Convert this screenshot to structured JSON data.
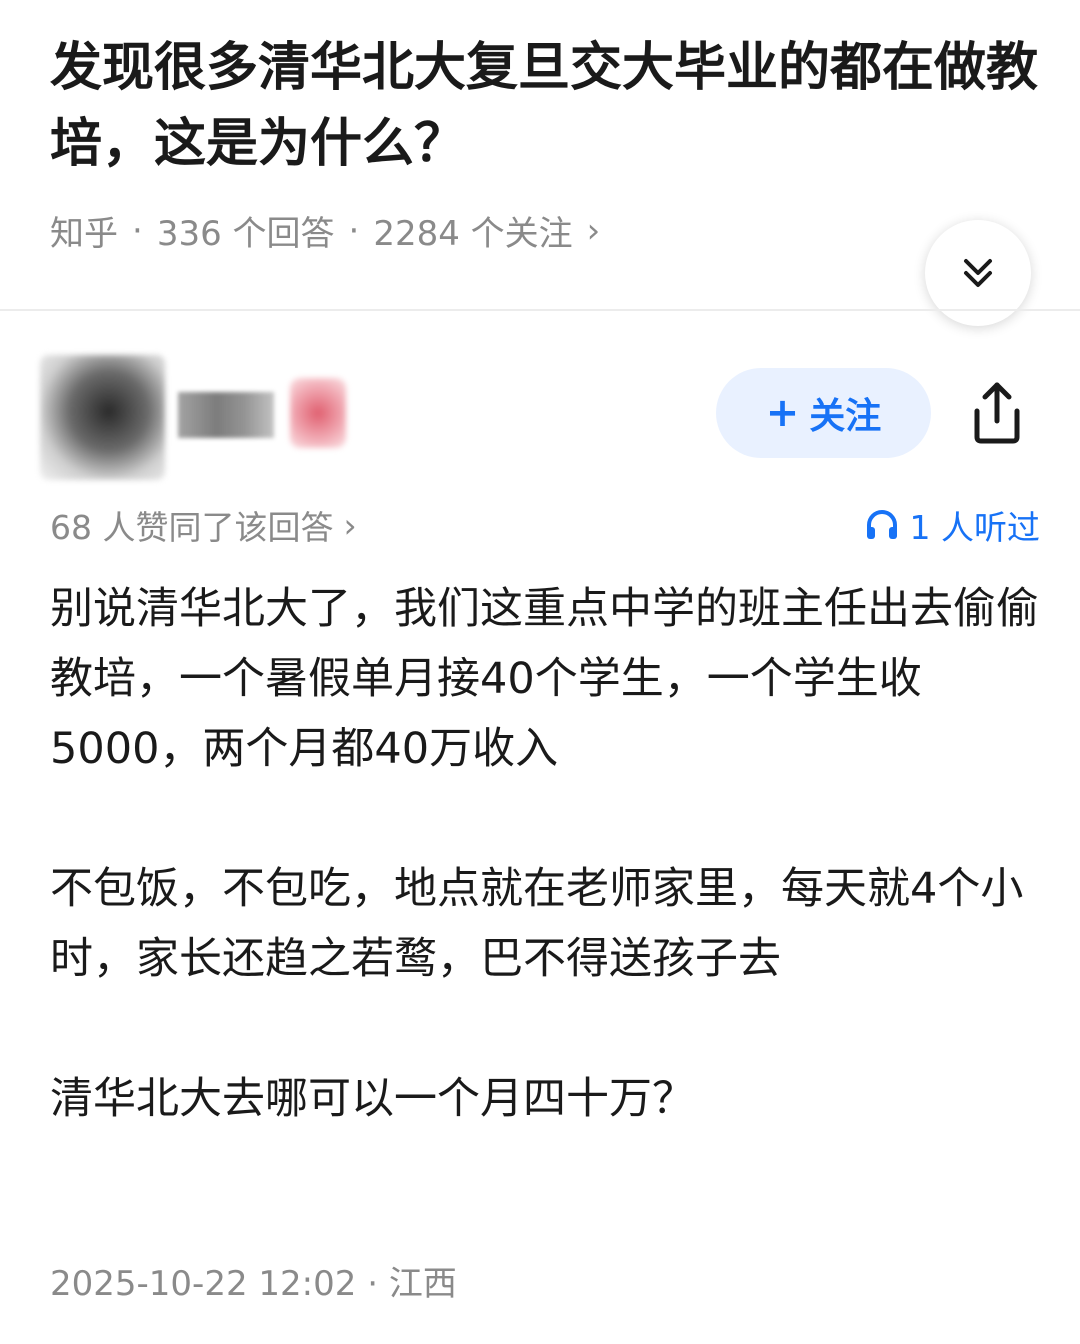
{
  "question": {
    "title": "发现很多清华北大复旦交大毕业的都在做教培，这是为什么？",
    "source": "知乎",
    "answers_count": "336 个回答",
    "followers_count": "2284 个关注",
    "separator": "·",
    "chevron": "›"
  },
  "author": {
    "follow_label": "关注",
    "follow_icon": "plus-icon",
    "share_icon": "share-icon"
  },
  "stats": {
    "votes_text": "68 人赞同了该回答",
    "chevron": "›",
    "listened_text": "1 人听过",
    "listened_icon": "headphones-icon"
  },
  "answer": {
    "paragraphs": [
      "别说清华北大了，我们这重点中学的班主任出去偷偷教培，一个暑假单月接40个学生，一个学生收5000，两个月都40万收入",
      "不包饭，不包吃，地点就在老师家里，每天就4个小时，家长还趋之若鹜，巴不得送孩子去",
      "清华北大去哪可以一个月四十万？"
    ]
  },
  "footer": {
    "datetime": "2025-10-22 12:02",
    "separator": "·",
    "location": "江西"
  },
  "colors": {
    "accent": "#1772f6",
    "follow_bg": "#e9f1ff",
    "meta_gray": "#8a8a8a",
    "text": "#1a1a1a"
  }
}
